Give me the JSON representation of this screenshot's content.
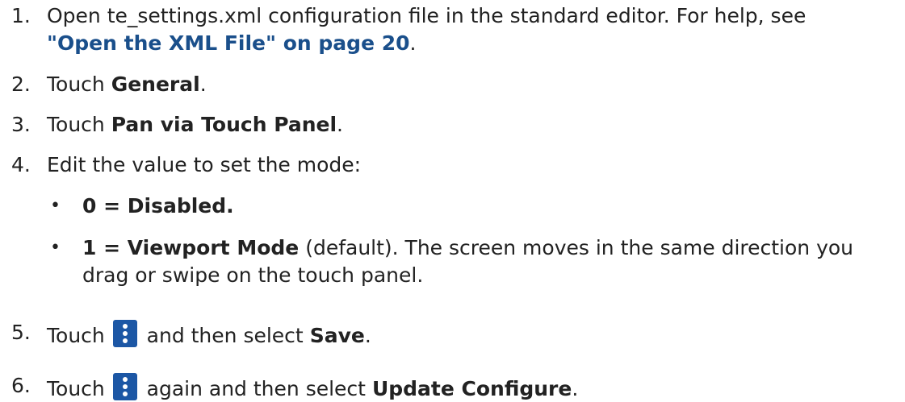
{
  "steps": [
    {
      "number": "1.",
      "text_a": "Open te_settings.xml configuration file in the standard editor. For help, see",
      "link": "\"Open the XML File\" on page 20",
      "text_b": "."
    },
    {
      "number": "2.",
      "pre": "Touch ",
      "bold": "General",
      "post": "."
    },
    {
      "number": "3.",
      "pre": "Touch ",
      "bold": "Pan via Touch Panel",
      "post": "."
    },
    {
      "number": "4.",
      "text": "Edit the value to set the mode:"
    },
    {
      "number": "5.",
      "pre": "Touch ",
      "post_icon": " and then select ",
      "bold": "Save",
      "post": "."
    },
    {
      "number": "6.",
      "pre": "Touch ",
      "post_icon": " again and then select ",
      "bold": "Update Configure",
      "post": "."
    }
  ],
  "bullets": [
    {
      "bullet": "•",
      "bold": "0 = Disabled."
    },
    {
      "bullet": "•",
      "bold": "1 = Viewport Mode",
      "text": " (default). The screen moves in the same direction you",
      "text2": "drag or swipe on the touch panel."
    }
  ],
  "icons": {
    "menu": "vertical-dots-menu-icon",
    "menu_color": "#1c57a5"
  },
  "colors": {
    "link": "#1a4f8b",
    "text": "#222222"
  }
}
